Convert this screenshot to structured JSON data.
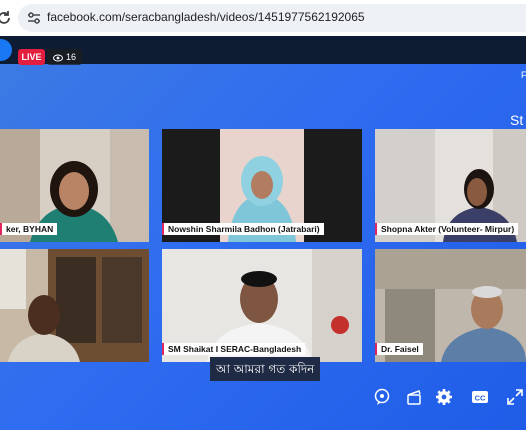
{
  "browser": {
    "url": "facebook.com/seracbangladesh/videos/1451977562192065",
    "reload_icon": "reload-icon",
    "site_info_icon": "tune-icon"
  },
  "player": {
    "live_label": "LIVE",
    "viewer_count": "16",
    "edge_text_top": "F",
    "edge_text_slide": "St"
  },
  "participants": [
    {
      "name": "ker, BYHAN"
    },
    {
      "name": "Nowshin Sharmila Badhon (Jatrabari)"
    },
    {
      "name": "Shopna Akter (Volunteer- Mirpur)"
    },
    {
      "name": ""
    },
    {
      "name": "SM Shaikat I SERAC-Bangladesh"
    },
    {
      "name": "Dr. Faisel"
    }
  ],
  "caption": "আ আমরা গত কদিন",
  "controls": [
    "comment-icon",
    "clapper-icon",
    "gear-icon",
    "cc-icon",
    "fullscreen-icon"
  ],
  "colors": {
    "background": "#2f6cf0",
    "live": "#e41e3f",
    "label_accent": "#e0245e"
  }
}
